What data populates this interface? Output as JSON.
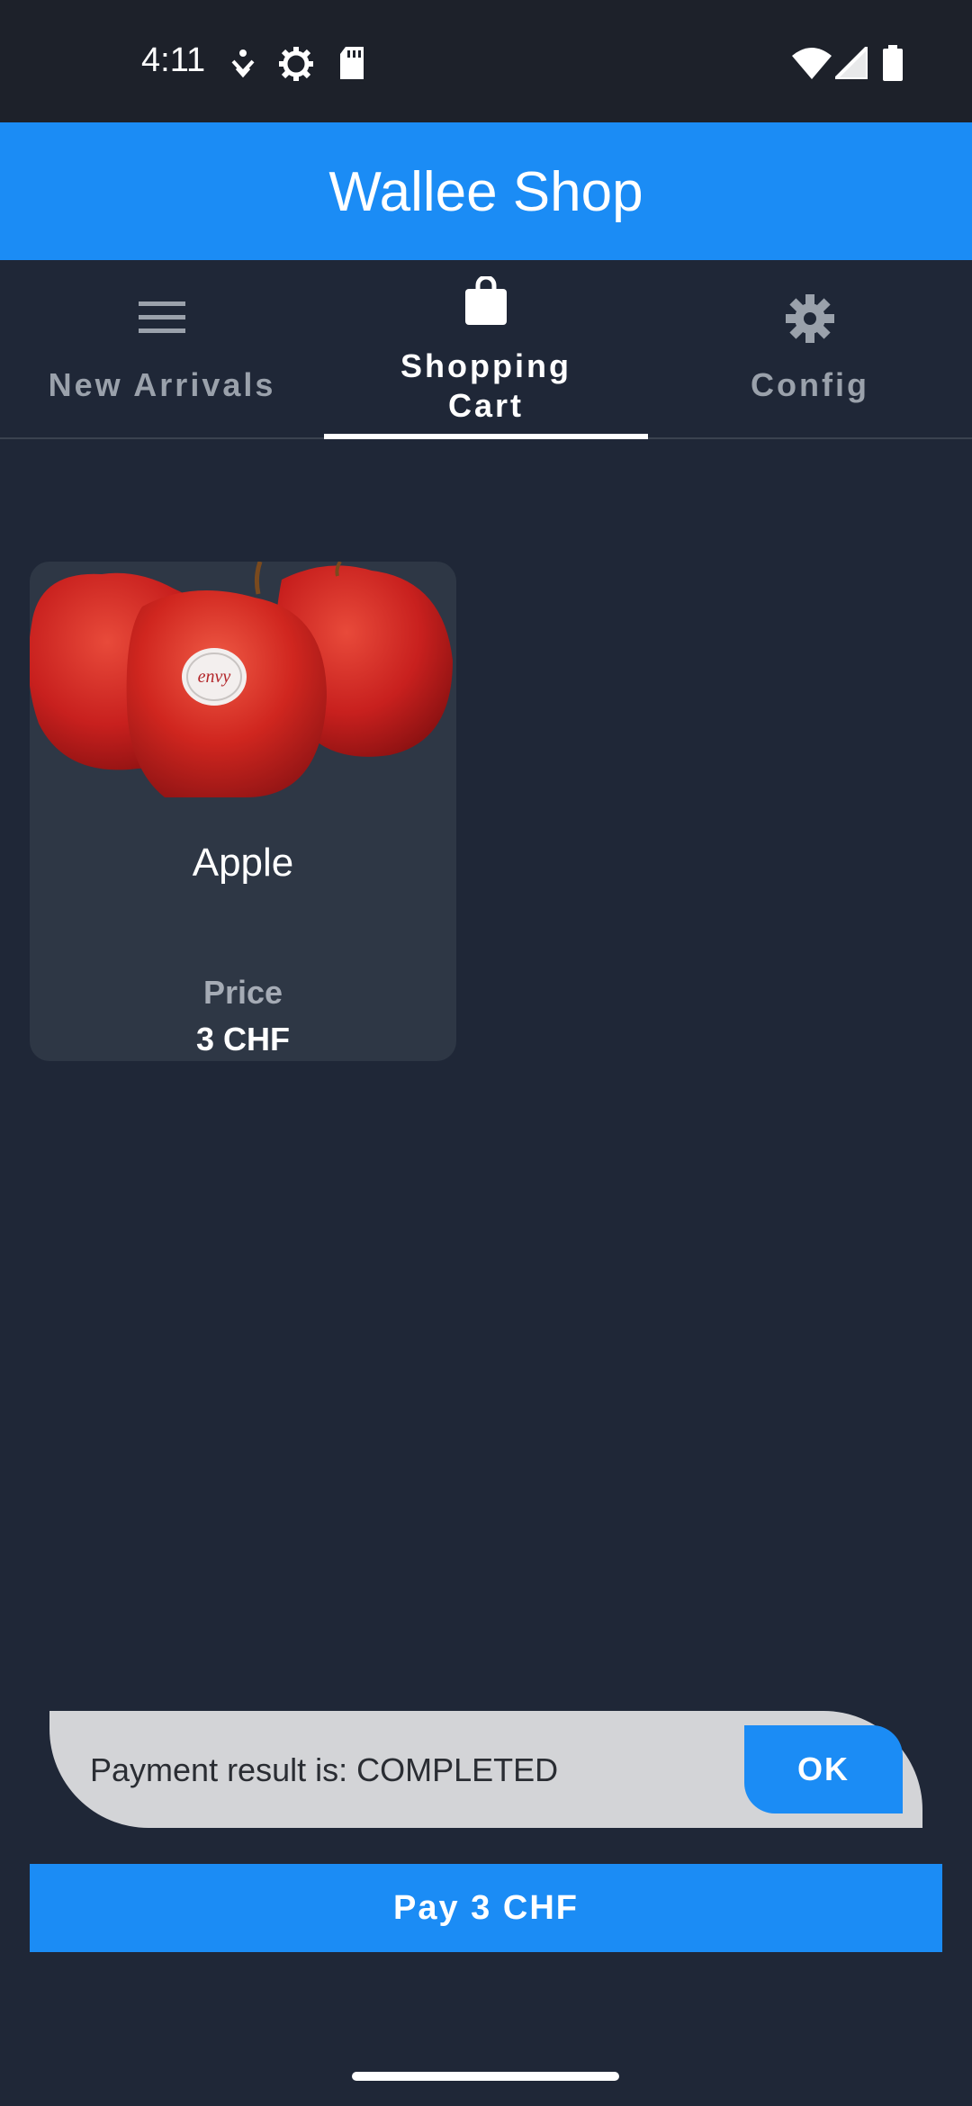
{
  "status_bar": {
    "time": "4:11",
    "icons_left": [
      "accessibility-icon",
      "settings-cog-icon",
      "sd-card-icon"
    ],
    "icons_right": [
      "wifi-icon",
      "signal-icon",
      "battery-icon"
    ]
  },
  "app_bar": {
    "title": "Wallee Shop",
    "color": "#1b8cf5"
  },
  "tabs": [
    {
      "label": "New Arrivals",
      "icon": "menu-icon",
      "selected": false
    },
    {
      "label_line1": "Shopping",
      "label_line2": "Cart",
      "icon": "shopping-bag-icon",
      "selected": true
    },
    {
      "label": "Config",
      "icon": "gear-icon",
      "selected": false
    }
  ],
  "cart": {
    "items": [
      {
        "name": "Apple",
        "price_label": "Price",
        "price_value": "3 CHF",
        "image": "apple-image",
        "image_sticker": "envy"
      }
    ]
  },
  "snackbar": {
    "message": "Payment result is: COMPLETED",
    "action_label": "OK"
  },
  "pay_button": {
    "label": "Pay 3 CHF"
  },
  "colors": {
    "background": "#1f2737",
    "accent": "#1b8cf5",
    "card": "#2e3745"
  }
}
